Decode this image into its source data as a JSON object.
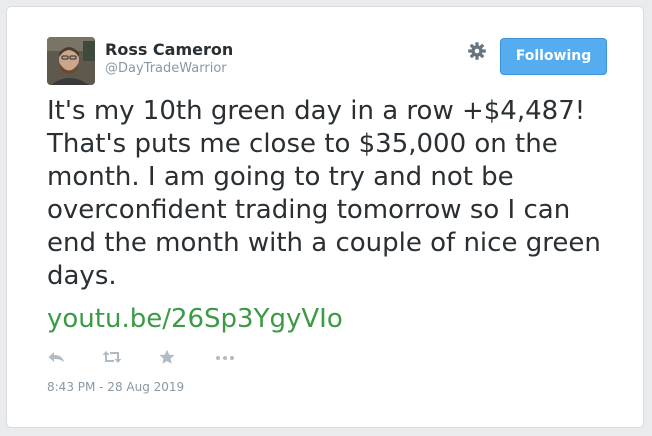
{
  "tweet": {
    "author": {
      "name": "Ross Cameron",
      "handle": "@DayTradeWarrior"
    },
    "follow_label": "Following",
    "text": "It's my 10th green day in a row +$4,487! That's puts me close to $35,000 on the month. I am going to try and not be overconfident trading tomorrow so I can end the month with a couple of nice green days.",
    "link_text": "youtu.be/26Sp3YgyVIo",
    "timestamp": "8:43 PM - 28 Aug 2019"
  },
  "actions": [
    "reply-icon",
    "retweet-icon",
    "favorite-icon",
    "more-icon"
  ],
  "colors": {
    "follow_button": "#55acee",
    "link": "#3b9a44",
    "text": "#292f33",
    "muted": "#8899a6"
  }
}
